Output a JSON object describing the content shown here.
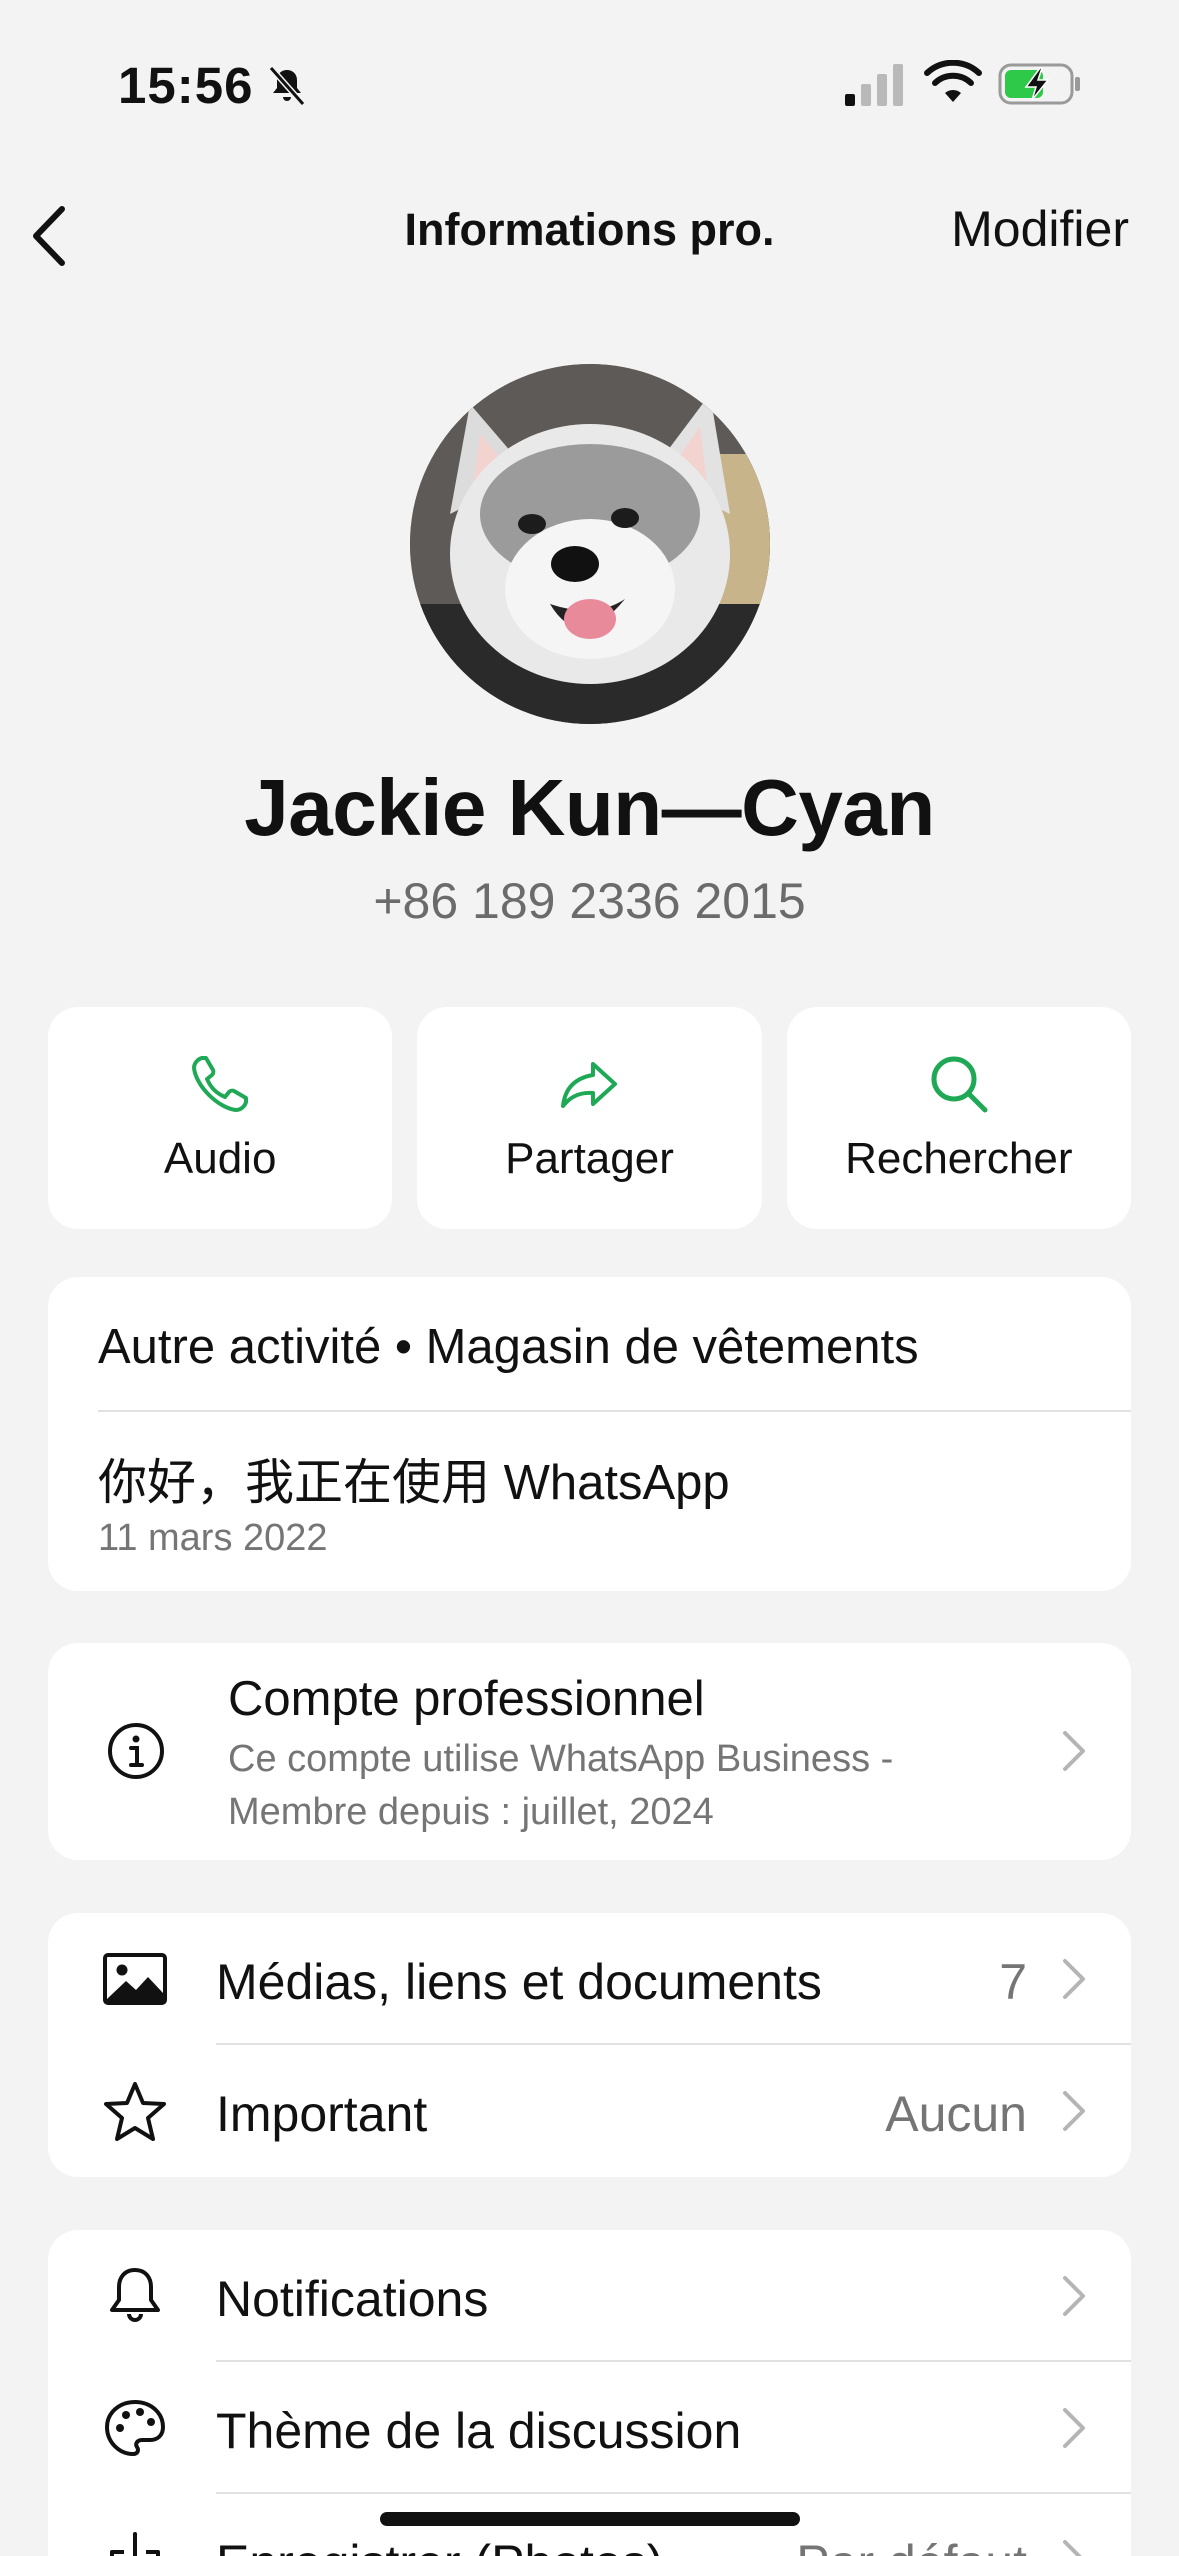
{
  "status_bar": {
    "time": "15:56"
  },
  "nav": {
    "title": "Informations pro.",
    "edit_label": "Modifier"
  },
  "profile": {
    "name": "Jackie Kun—Cyan",
    "phone": "+86 189 2336 2015"
  },
  "actions": [
    {
      "label": "Audio",
      "icon": "phone-icon"
    },
    {
      "label": "Partager",
      "icon": "share-arrow-icon"
    },
    {
      "label": "Rechercher",
      "icon": "search-icon"
    }
  ],
  "about": {
    "category": "Autre activité • Magasin de vêtements",
    "status": "你好，我正在使用 WhatsApp",
    "date": "11 mars 2022"
  },
  "business": {
    "title": "Compte professionnel",
    "line1": "Ce compte utilise WhatsApp Business -",
    "line2": "Membre depuis : juillet, 2024"
  },
  "media_rows": [
    {
      "label": "Médias, liens et documents",
      "value": "7",
      "icon": "image-icon"
    },
    {
      "label": "Important",
      "value": "Aucun",
      "icon": "star-icon"
    }
  ],
  "settings_rows": [
    {
      "label": "Notifications",
      "icon": "bell-icon"
    },
    {
      "label": "Thème de la discussion",
      "icon": "palette-icon"
    },
    {
      "label": "Enregistrer (Photos)",
      "value": "Par défaut",
      "icon": "download-icon"
    }
  ],
  "colors": {
    "accent": "#1fa855",
    "background": "#f3f3f3",
    "card": "#ffffff",
    "secondary_text": "#757575"
  }
}
